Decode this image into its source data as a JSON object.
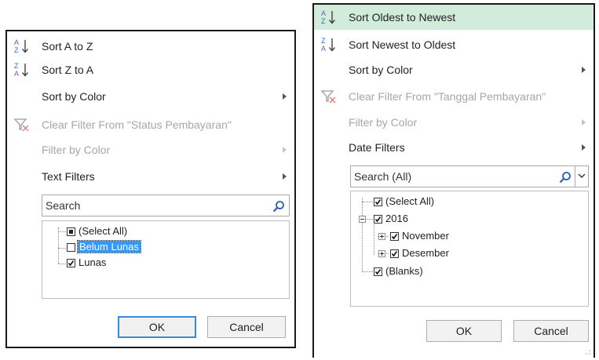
{
  "left_menu": {
    "sort_asc": "Sort A to Z",
    "sort_desc": "Sort Z to A",
    "sort_by_color": "Sort by Color",
    "clear_filter": "Clear Filter From \"Status Pembayaran\"",
    "filter_by_color": "Filter by Color",
    "text_filters": "Text Filters",
    "search_placeholder": "Search",
    "items": [
      "(Select All)",
      "Belum Lunas",
      "Lunas"
    ],
    "ok": "OK",
    "cancel": "Cancel"
  },
  "right_menu": {
    "sort_asc": "Sort Oldest to Newest",
    "sort_desc": "Sort Newest to Oldest",
    "sort_by_color": "Sort by Color",
    "clear_filter": "Clear Filter From \"Tanggal Pembayaran\"",
    "filter_by_color": "Filter by Color",
    "date_filters": "Date Filters",
    "search_placeholder": "Search (All)",
    "tree": {
      "select_all": "(Select All)",
      "year": "2016",
      "month1": "November",
      "month2": "Desember",
      "blanks": "(Blanks)"
    },
    "ok": "OK",
    "cancel": "Cancel"
  },
  "colors": {
    "highlight": "#d2ecdc",
    "selection": "#3399ff",
    "ok_border": "#3c8ad6"
  }
}
